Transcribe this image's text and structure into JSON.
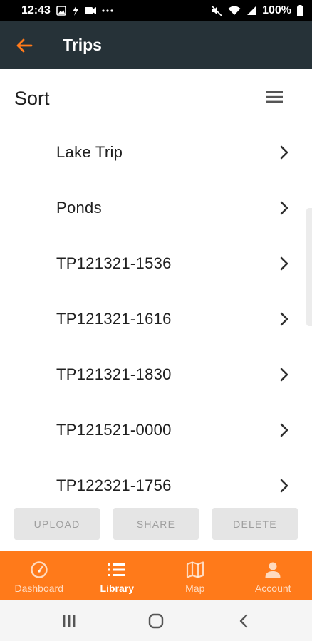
{
  "status_bar": {
    "time": "12:43",
    "battery": "100%",
    "icons_left": [
      "image-icon",
      "flash-icon",
      "video-icon",
      "more-dots-icon"
    ],
    "icons_right": [
      "mute-icon",
      "wifi-icon",
      "signal-icon",
      "battery-icon"
    ]
  },
  "app_bar": {
    "title": "Trips",
    "back_icon": "arrow-left-icon",
    "accent_color": "#ff7a1a",
    "background": "#263238"
  },
  "sort": {
    "label": "Sort",
    "menu_icon": "hamburger-menu-icon"
  },
  "trips": [
    {
      "name": "Lake Trip"
    },
    {
      "name": "Ponds"
    },
    {
      "name": "TP121321-1536"
    },
    {
      "name": "TP121321-1616"
    },
    {
      "name": "TP121321-1830"
    },
    {
      "name": "TP121521-0000"
    },
    {
      "name": "TP122321-1756"
    }
  ],
  "actions": {
    "upload": "UPLOAD",
    "share": "SHARE",
    "delete": "DELETE"
  },
  "bottom_nav": {
    "items": [
      {
        "label": "Dashboard",
        "icon": "speedometer-icon",
        "active": false
      },
      {
        "label": "Library",
        "icon": "list-icon",
        "active": true
      },
      {
        "label": "Map",
        "icon": "map-icon",
        "active": false
      },
      {
        "label": "Account",
        "icon": "person-icon",
        "active": false
      }
    ],
    "background": "#ff7a1a"
  },
  "system_nav": {
    "icons": [
      "recent-apps-icon",
      "home-icon",
      "back-icon"
    ]
  }
}
